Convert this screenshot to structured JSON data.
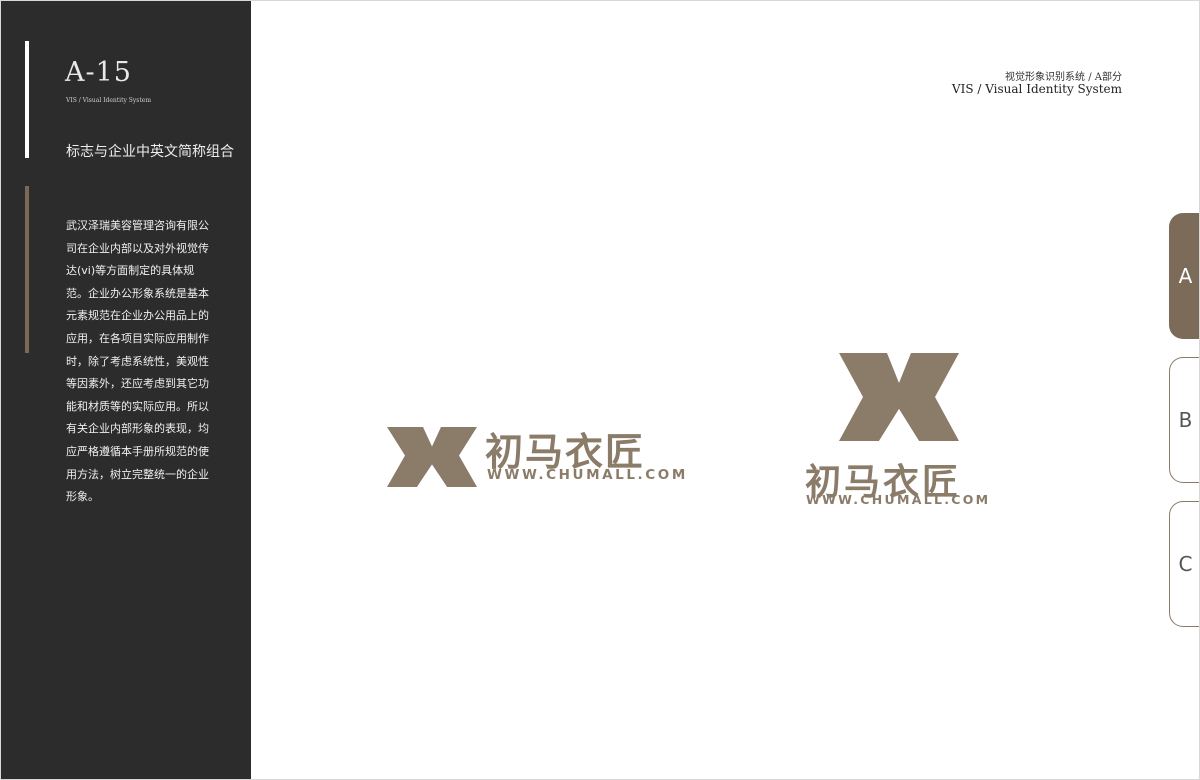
{
  "sidebar": {
    "page_code": "A-15",
    "page_sub": "VIS / Visual Identity System",
    "section_title": "标志与企业中英文简称组合",
    "body_lines": [
      "武汉泽瑞美容管理咨询有限公",
      "司在企业内部以及对外视觉传",
      "达(vi)等方面制定的具体规",
      "范。企业办公形象系统是基本",
      "元素规范在企业办公用品上的",
      "应用，在各项目实际应用制作",
      "时，除了考虑系统性，美观性",
      "等因素外，还应考虑到其它功",
      "能和材质等的实际应用。所以",
      "有关企业内部形象的表现，均",
      "应严格遵循本手册所规范的使",
      "用方法，树立完整统一的企业",
      "形象。"
    ]
  },
  "header": {
    "title_cn": "视觉形象识别系统 / A部分",
    "title_en": "VIS / Visual Identity System"
  },
  "tabs": [
    {
      "label": "A",
      "active": true
    },
    {
      "label": "B",
      "active": false
    },
    {
      "label": "C",
      "active": false
    }
  ],
  "logos": {
    "brand_name": "初马衣匠",
    "website": "WWW.CHUMALL.COM",
    "color": "#8b7b69",
    "mark_icon": "m-chevron-logo-icon"
  }
}
